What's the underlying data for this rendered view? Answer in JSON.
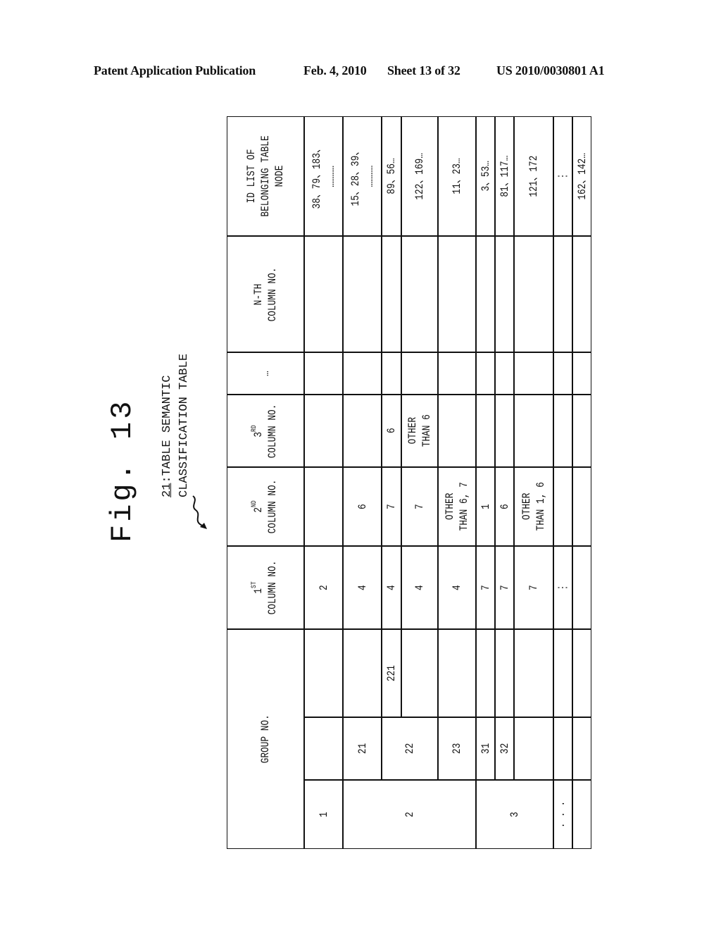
{
  "header": {
    "publication": "Patent Application Publication",
    "date": "Feb. 4, 2010",
    "sheet": "Sheet 13 of 32",
    "number": "US 2010/0030801 A1"
  },
  "figure": {
    "title": "Fig. 13",
    "ref_number": "21",
    "caption_line1": ":TABLE SEMANTIC",
    "caption_line2": "CLASSIFICATION TABLE",
    "leader_icon": "wavy-arrow"
  },
  "table": {
    "headers": {
      "group": "GROUP NO.",
      "col1_num": "1",
      "col1_sup": "ST",
      "col1_rest": "COLUMN NO.",
      "col2_num": "2",
      "col2_sup": "ND",
      "col2_rest": "COLUMN NO.",
      "col3_num": "3",
      "col3_sup": "RD",
      "col3_rest": "COLUMN NO.",
      "ellipsis": "…",
      "nth": "N-TH\nCOLUMN NO.",
      "idlist": "ID LIST OF\nBELONGING TABLE\nNODE"
    },
    "groups_level1": [
      {
        "label": "1"
      },
      {
        "label": "2"
      },
      {
        "label": "3"
      },
      {
        "label": "· · ·"
      },
      {
        "label": ""
      }
    ],
    "groups_level2": [
      "",
      "21",
      "22",
      "23",
      "31",
      "32",
      "",
      "",
      ""
    ],
    "groups_level3": [
      "",
      "",
      "221",
      "",
      "",
      "",
      "",
      "",
      "",
      ""
    ],
    "rows": [
      {
        "col1": "2",
        "col2": "",
        "col3": "",
        "ellipsis": "",
        "nth": "",
        "ids": "38、79、183、\n…………"
      },
      {
        "col1": "4",
        "col2": "6",
        "col3": "",
        "ellipsis": "",
        "nth": "",
        "ids": "15、28、39、\n…………"
      },
      {
        "col1": "4",
        "col2": "7",
        "col3": "6",
        "ellipsis": "",
        "nth": "",
        "ids": "89、56…"
      },
      {
        "col1": "4",
        "col2": "7",
        "col3": "OTHER\nTHAN 6",
        "ellipsis": "",
        "nth": "",
        "ids": "122、169…"
      },
      {
        "col1": "4",
        "col2": "OTHER\nTHAN 6, 7",
        "col3": "",
        "ellipsis": "",
        "nth": "",
        "ids": "11、23…"
      },
      {
        "col1": "7",
        "col2": "1",
        "col3": "",
        "ellipsis": "",
        "nth": "",
        "ids": "3、53…"
      },
      {
        "col1": "7",
        "col2": "6",
        "col3": "",
        "ellipsis": "",
        "nth": "",
        "ids": "81、117…"
      },
      {
        "col1": "7",
        "col2": "OTHER\nTHAN 1, 6",
        "col3": "",
        "ellipsis": "",
        "nth": "",
        "ids": "121、172"
      },
      {
        "col1": "⋮",
        "col2": "",
        "col3": "",
        "ellipsis": "",
        "nth": "",
        "ids": "⋮"
      },
      {
        "col1": "",
        "col2": "",
        "col3": "",
        "ellipsis": "",
        "nth": "",
        "ids": "162、142…"
      }
    ]
  }
}
